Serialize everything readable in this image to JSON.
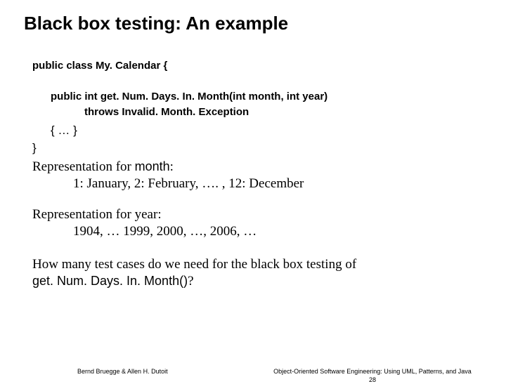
{
  "title": "Black box testing: An example",
  "code": {
    "l1": "public class My. Calendar {",
    "l2": "public int get. Num. Days. In. Month(int month, int year)",
    "l3": "throws Invalid. Month. Exception",
    "l4": "{ … }",
    "l5": "}"
  },
  "rep_month": {
    "label_pre": "Representation for ",
    "kw": "month",
    "label_post": ":",
    "values": "1: January, 2: February, …. , 12: December"
  },
  "rep_year": {
    "label_pre": "Representation for ",
    "kw": "year",
    "label_post": ":",
    "values": "1904, … 1999, 2000, …, 2006, …"
  },
  "question": {
    "line1": "How many test cases do we need for the black box testing of",
    "fn": "get. Num. Days. In. Month()",
    "q": "?"
  },
  "footer": {
    "left": "Bernd Bruegge & Allen H. Dutoit",
    "right": "Object-Oriented Software Engineering: Using UML, Patterns, and Java",
    "page": "28"
  }
}
